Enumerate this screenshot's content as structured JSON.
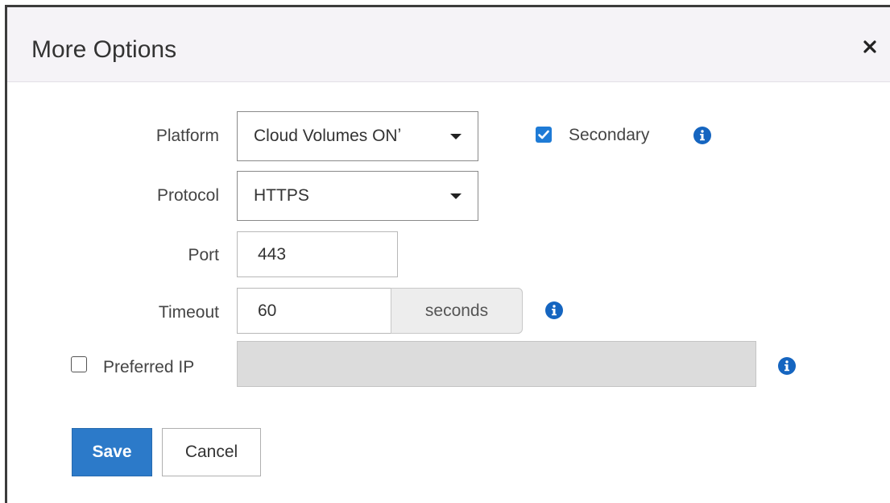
{
  "dialog": {
    "title": "More Options",
    "close_icon": "close-icon"
  },
  "form": {
    "platform": {
      "label": "Platform",
      "selected": "Cloud Volumes ONTAP",
      "display_text": "Cloud Volumes ONʼ"
    },
    "secondary": {
      "label": "Secondary",
      "checked": true
    },
    "protocol": {
      "label": "Protocol",
      "selected": "HTTPS"
    },
    "port": {
      "label": "Port",
      "value": "443"
    },
    "timeout": {
      "label": "Timeout",
      "value": "60",
      "unit": "seconds"
    },
    "preferred_ip": {
      "label": "Preferred IP",
      "checked": false,
      "value": ""
    }
  },
  "actions": {
    "save_label": "Save",
    "cancel_label": "Cancel"
  },
  "colors": {
    "primary": "#2c7ac9",
    "checkbox": "#1e7bd6",
    "info_icon": "#1565c0",
    "header_bg": "#f5f3f7"
  }
}
